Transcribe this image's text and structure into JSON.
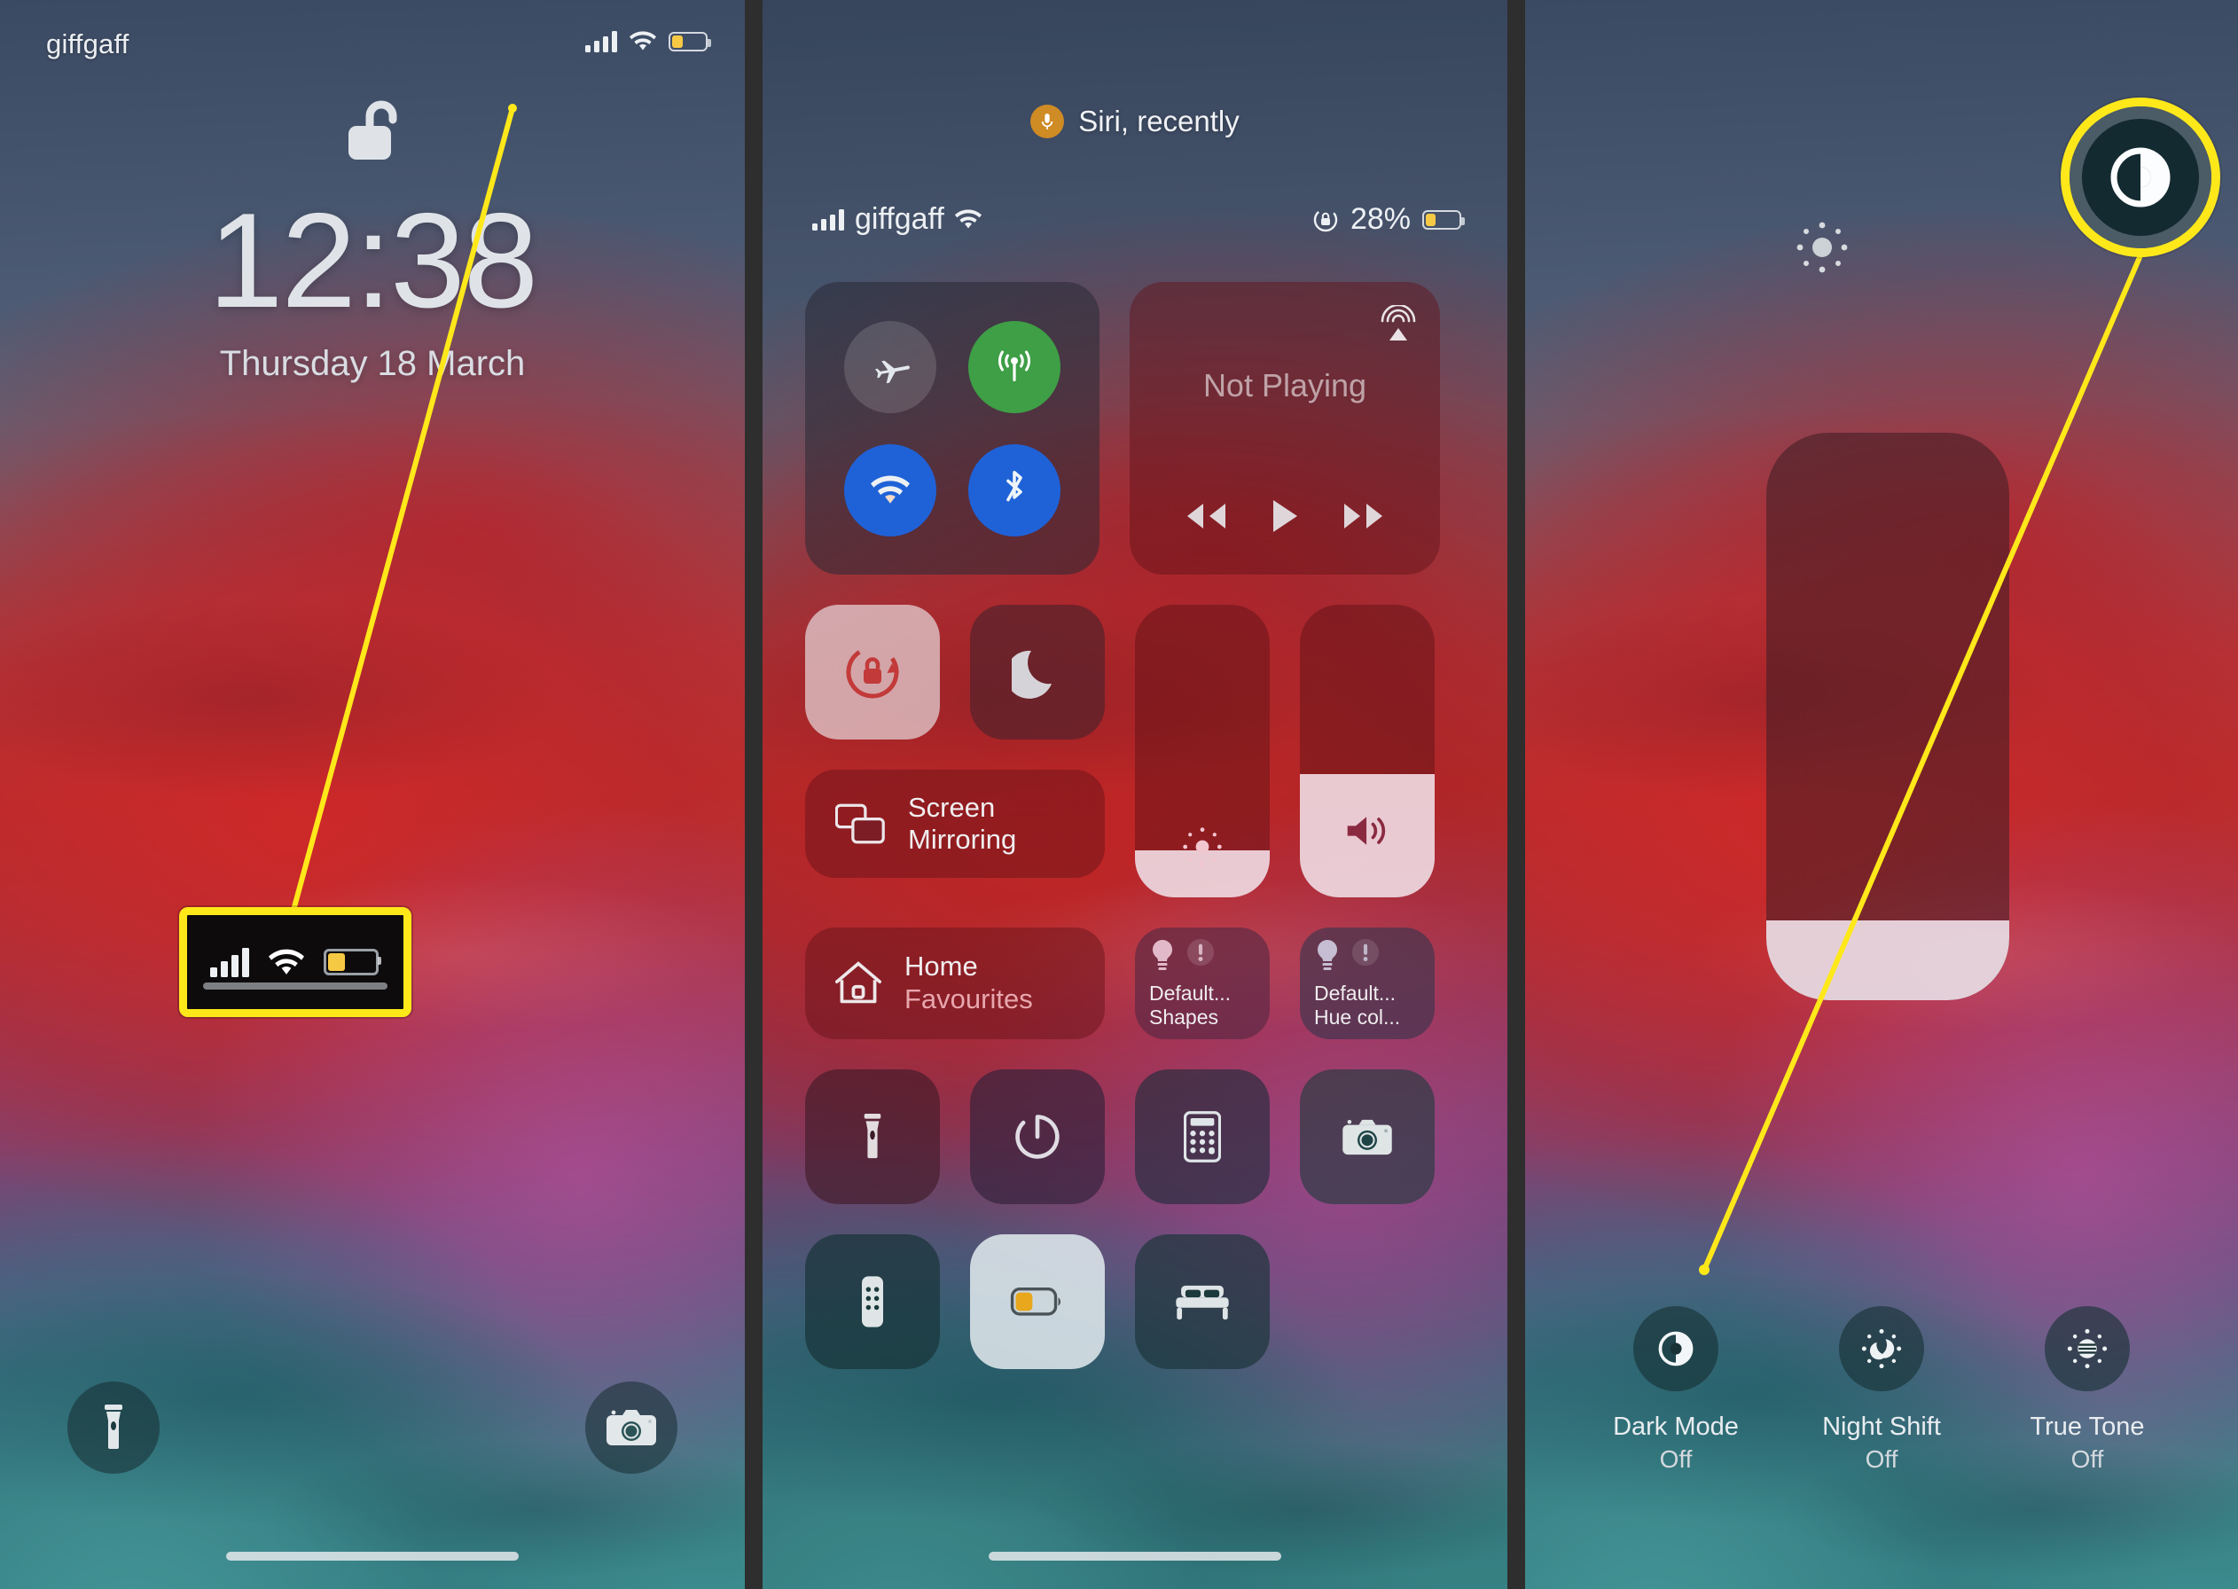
{
  "colors": {
    "highlight_yellow": "#ffe81a",
    "battery_yellow": "#f6c945",
    "cellular_green": "#3e9f46",
    "toggle_blue": "#1f62d8",
    "siri_orange": "#cf8b24",
    "slider_fill": "#f0e2ea"
  },
  "panel1": {
    "name": "lock-screen",
    "carrier": "giffgaff",
    "time": "12:38",
    "date": "Thursday 18 March",
    "status": {
      "signal_bars": 4,
      "wifi": "wifi-icon",
      "battery_low_power": true,
      "battery_fill_percent": 30
    },
    "unlock_icon": "unlock-icon",
    "quick_actions": [
      {
        "name": "flashlight",
        "icon": "flashlight-icon"
      },
      {
        "name": "camera",
        "icon": "camera-icon"
      }
    ],
    "callout": {
      "type": "zoom-box",
      "contents": [
        "signal-bars-icon",
        "wifi-icon",
        "low-power-battery-icon"
      ]
    }
  },
  "panel2": {
    "name": "control-center",
    "siri": {
      "label": "Siri, recently",
      "icon": "microphone-icon"
    },
    "status": {
      "signal_bars": 4,
      "carrier": "giffgaff",
      "wifi": "wifi-icon",
      "rotation_lock": "rotation-lock-icon",
      "battery_percent": "28%",
      "battery_low_power": true
    },
    "connectivity": [
      {
        "label": "Airplane Mode",
        "icon": "airplane-icon",
        "state": "off"
      },
      {
        "label": "Cellular Data",
        "icon": "cellular-icon",
        "state": "on"
      },
      {
        "label": "Wi-Fi",
        "icon": "wifi-icon",
        "state": "on"
      },
      {
        "label": "Bluetooth",
        "icon": "bluetooth-icon",
        "state": "on"
      }
    ],
    "media": {
      "title": "Not Playing",
      "airplay_icon": "airplay-icon",
      "controls": [
        "rewind-icon",
        "play-icon",
        "fastforward-icon"
      ]
    },
    "toggles": [
      {
        "label": "Portrait Orientation Lock",
        "icon": "rotation-lock-icon",
        "state": "on"
      },
      {
        "label": "Do Not Disturb",
        "icon": "moon-icon",
        "state": "off"
      }
    ],
    "screen_mirroring": {
      "line1": "Screen",
      "line2": "Mirroring",
      "icon": "screen-mirroring-icon"
    },
    "brightness": {
      "icon": "brightness-icon",
      "level_percent": 16
    },
    "volume": {
      "icon": "volume-icon",
      "level_percent": 42
    },
    "home": {
      "line1": "Home",
      "line2": "Favourites",
      "icon": "home-icon"
    },
    "lights": [
      {
        "line1": "Default...",
        "line2": "Shapes",
        "icon": "lightbulb-icon",
        "status_icon": "alert-icon"
      },
      {
        "line1": "Default...",
        "line2": "Hue col...",
        "icon": "lightbulb-icon",
        "status_icon": "alert-icon"
      }
    ],
    "apps_row1": [
      {
        "label": "Flashlight",
        "icon": "flashlight-icon"
      },
      {
        "label": "Timer",
        "icon": "timer-icon"
      },
      {
        "label": "Calculator",
        "icon": "calculator-icon"
      },
      {
        "label": "Camera",
        "icon": "camera-icon"
      }
    ],
    "apps_row2": [
      {
        "label": "Apple TV Remote",
        "icon": "remote-icon"
      },
      {
        "label": "Low Power Mode",
        "icon": "low-power-battery-icon",
        "state": "on"
      },
      {
        "label": "Sleep",
        "icon": "bed-icon"
      }
    ],
    "callout": {
      "type": "zoom-circle",
      "target": "brightness-slider"
    }
  },
  "panel3": {
    "name": "display-brightness-expanded",
    "sun_icon": "brightness-icon",
    "brightness_level_percent": 14,
    "options": [
      {
        "label": "Dark Mode",
        "value": "Off",
        "icon": "dark-mode-icon"
      },
      {
        "label": "Night Shift",
        "value": "Off",
        "icon": "night-shift-icon"
      },
      {
        "label": "True Tone",
        "value": "Off",
        "icon": "true-tone-icon"
      }
    ],
    "callout": {
      "type": "zoom-circle",
      "target": "dark-mode-button"
    }
  }
}
